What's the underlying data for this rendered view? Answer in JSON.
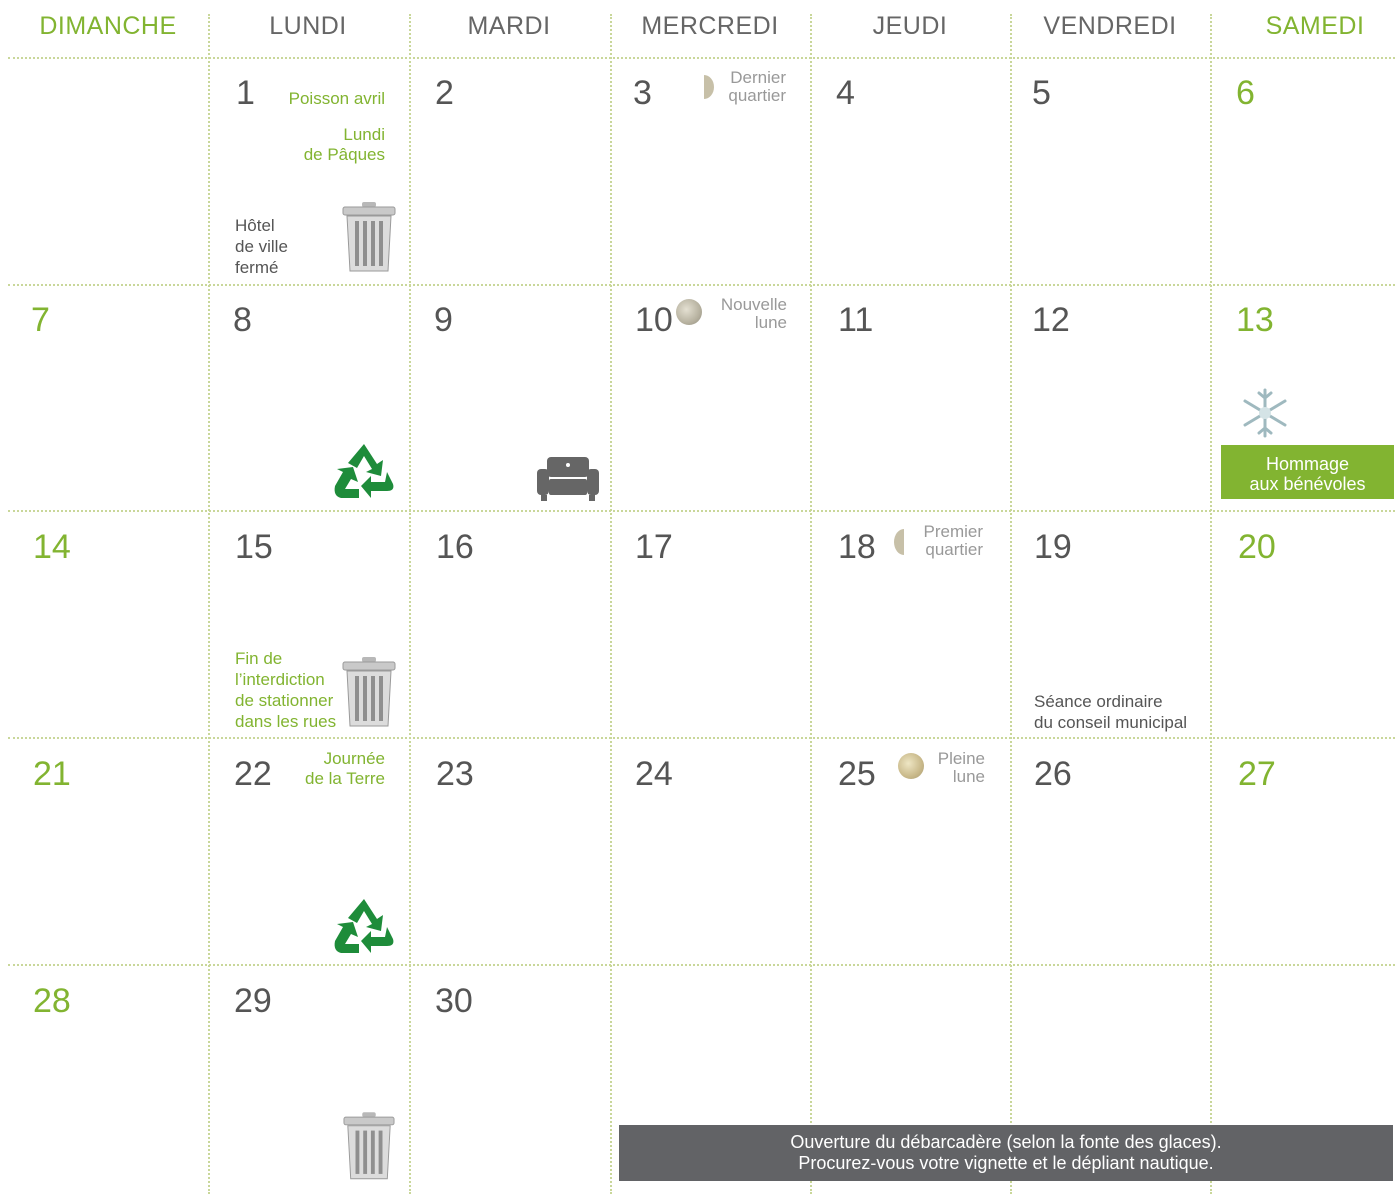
{
  "days": [
    "DIMANCHE",
    "LUNDI",
    "MARDI",
    "MERCREDI",
    "JEUDI",
    "VENDREDI",
    "SAMEDI"
  ],
  "colors": {
    "accent": "#82b431",
    "text": "#555555",
    "banner": "#626366",
    "grid": "#c9d79a"
  },
  "dates": {
    "d1": "1",
    "d2": "2",
    "d3": "3",
    "d4": "4",
    "d5": "5",
    "d6": "6",
    "d7": "7",
    "d8": "8",
    "d9": "9",
    "d10": "10",
    "d11": "11",
    "d12": "12",
    "d13": "13",
    "d14": "14",
    "d15": "15",
    "d16": "16",
    "d17": "17",
    "d18": "18",
    "d19": "19",
    "d20": "20",
    "d21": "21",
    "d22": "22",
    "d23": "23",
    "d24": "24",
    "d25": "25",
    "d26": "26",
    "d27": "27",
    "d28": "28",
    "d29": "29",
    "d30": "30"
  },
  "events": {
    "poisson": "Poisson avril",
    "paques_1": "Lundi",
    "paques_2": "de Pâques",
    "hotel_1": "Hôtel",
    "hotel_2": "de ville",
    "hotel_3": "fermé",
    "dernier_1": "Dernier",
    "dernier_2": "quartier",
    "nouvelle_1": "Nouvelle",
    "nouvelle_2": "lune",
    "premier_1": "Premier",
    "premier_2": "quartier",
    "pleine_1": "Pleine",
    "pleine_2": "lune",
    "hommage_1": "Hommage",
    "hommage_2": "aux bénévoles",
    "fin_1": "Fin de",
    "fin_2": "l’interdiction",
    "fin_3": "de stationner",
    "fin_4": "dans les rues",
    "seance_1": "Séance ordinaire",
    "seance_2": "du conseil municipal",
    "terre_1": "Journée",
    "terre_2": "de la Terre",
    "banner_1": "Ouverture du débarcadère (selon la fonte des glaces).",
    "banner_2": "Procurez-vous votre vignette et le dépliant nautique."
  },
  "icons": {
    "garbage": "trash-can-icon",
    "recycling": "recycling-icon",
    "bulky": "armchair-icon",
    "snowflake": "snowflake-icon",
    "moon": "moon-phase-icon"
  }
}
